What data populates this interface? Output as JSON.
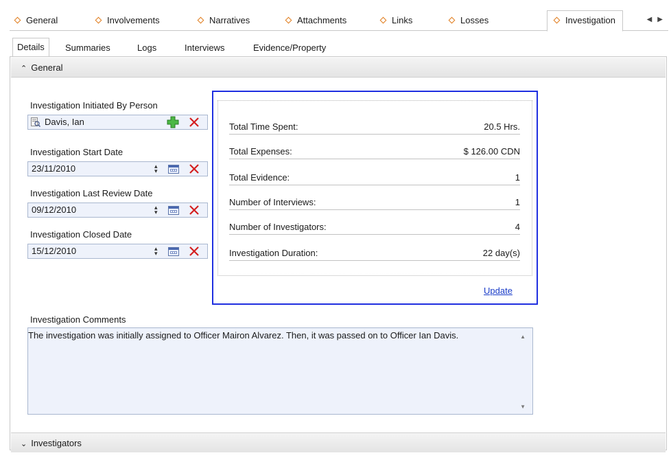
{
  "top_tabs": [
    {
      "label": "General"
    },
    {
      "label": "Involvements"
    },
    {
      "label": "Narratives"
    },
    {
      "label": "Attachments"
    },
    {
      "label": "Links"
    },
    {
      "label": "Losses"
    },
    {
      "label": "Investigation",
      "active": true
    }
  ],
  "sub_tabs": [
    {
      "label": "Details",
      "active": true
    },
    {
      "label": "Summaries"
    },
    {
      "label": "Logs"
    },
    {
      "label": "Interviews"
    },
    {
      "label": "Evidence/Property"
    }
  ],
  "sections": {
    "general": {
      "label": "General"
    },
    "investigators": {
      "label": "Investigators"
    }
  },
  "form": {
    "initiated_by": {
      "label": "Investigation Initiated By Person",
      "value": "Davis, Ian"
    },
    "start_date": {
      "label": "Investigation Start Date",
      "value": "23/11/2010"
    },
    "last_review_date": {
      "label": "Investigation Last Review Date",
      "value": "09/12/2010"
    },
    "closed_date": {
      "label": "Investigation Closed Date",
      "value": "15/12/2010"
    }
  },
  "summary": {
    "rows": [
      {
        "key": "Total Time Spent:",
        "value": "20.5 Hrs."
      },
      {
        "key": "Total Expenses:",
        "value": "$  126.00 CDN"
      },
      {
        "key": "Total Evidence:",
        "value": "1"
      },
      {
        "key": "Number of Interviews:",
        "value": "1"
      },
      {
        "key": "Number of Investigators:",
        "value": "4"
      },
      {
        "key": "Investigation Duration:",
        "value": "22 day(s)"
      }
    ],
    "update_label": "Update"
  },
  "comments": {
    "label": "Investigation Comments",
    "value": "The investigation was initially assigned to Officer Mairon Alvarez. Then, it was passed on to Officer Ian Davis."
  },
  "colors": {
    "accent_border": "#1f2fe0",
    "tab_marker": "#e07b1a",
    "delete_red": "#d42020",
    "add_green": "#3aa635",
    "link": "#1a3cc8"
  },
  "icons": [
    "diamond-icon",
    "person-lookup-icon",
    "add-icon",
    "delete-icon",
    "spinner-icon",
    "calendar-icon",
    "collapse-chevron-icon",
    "expand-chevron-icon",
    "tab-scroll-left-icon",
    "tab-scroll-right-icon"
  ]
}
